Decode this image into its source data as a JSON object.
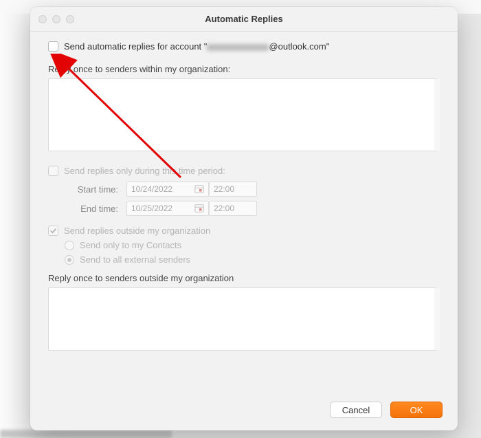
{
  "window": {
    "title": "Automatic Replies"
  },
  "main": {
    "sendReplies": {
      "label_prefix": "Send automatic replies for account \"",
      "account_suffix": "@outlook.com\"",
      "checked": false
    },
    "internal": {
      "label": "Reply once to senders within my organization:",
      "value": ""
    },
    "timePeriod": {
      "checkbox_label": "Send replies only during this time period:",
      "checked": false,
      "start_label": "Start time:",
      "start_date": "10/24/2022",
      "start_time": "22:00",
      "end_label": "End time:",
      "end_date": "10/25/2022",
      "end_time": "22:00"
    },
    "outside": {
      "checkbox_label": "Send replies outside my organization",
      "checked": true,
      "options": {
        "contacts": "Send only to my Contacts",
        "all": "Send to all external senders"
      },
      "selected": "all",
      "label": "Reply once to senders outside my organization",
      "value": ""
    }
  },
  "footer": {
    "cancel": "Cancel",
    "ok": "OK"
  },
  "annotation": {
    "arrow_target": "send-automatic-replies-checkbox"
  }
}
